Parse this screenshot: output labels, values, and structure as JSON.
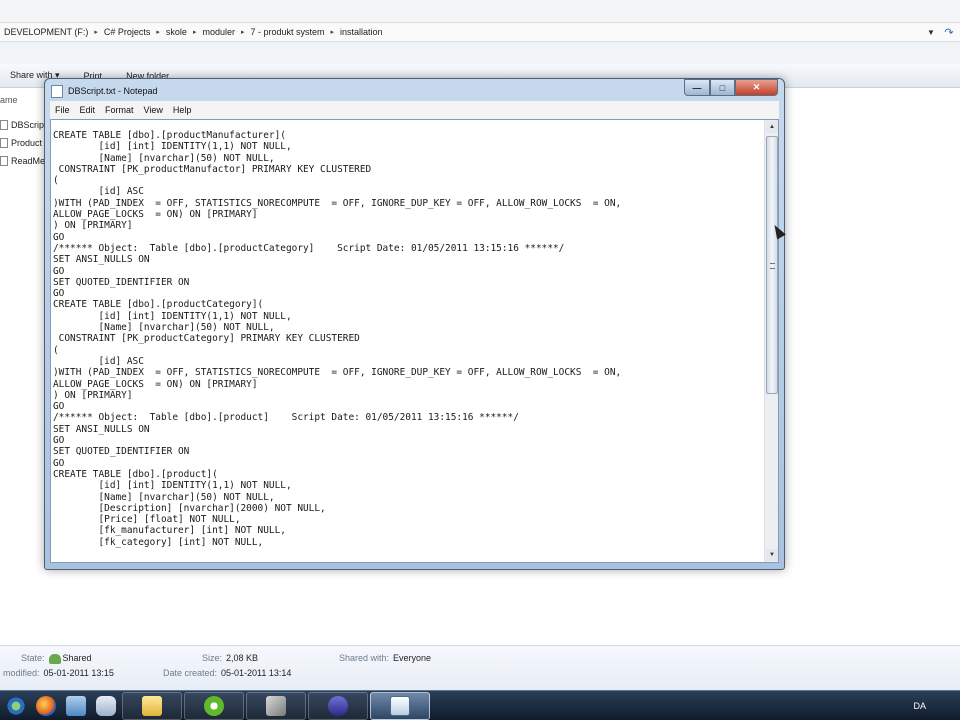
{
  "explorer": {
    "breadcrumbs": [
      "DEVELOPMENT (F:)",
      "C# Projects",
      "skole",
      "moduler",
      "7 - produkt system",
      "installation"
    ],
    "toolbar": {
      "share_with": "Share with ▾",
      "print": "Print",
      "new_folder": "New folder"
    },
    "column_header": "ame",
    "nav_items": [
      "DBScrip",
      "Product",
      "ReadMe"
    ],
    "details": {
      "state_label": "State:",
      "state_value": "Shared",
      "size_label": "Size:",
      "size_value": "2,08 KB",
      "shared_with_label": "Shared with:",
      "shared_with_value": "Everyone",
      "modified_label": "modified:",
      "modified_value": "05-01-2011 13:15",
      "created_label": "Date created:",
      "created_value": "05-01-2011 13:14"
    }
  },
  "notepad": {
    "title": "DBScript.txt - Notepad",
    "menu": [
      "File",
      "Edit",
      "Format",
      "View",
      "Help"
    ],
    "lines": [
      "CREATE TABLE [dbo].[productManufacturer](",
      "        [id] [int] IDENTITY(1,1) NOT NULL,",
      "        [Name] [nvarchar](50) NOT NULL,",
      " CONSTRAINT [PK_productManufactor] PRIMARY KEY CLUSTERED",
      "(",
      "        [id] ASC",
      ")WITH (PAD_INDEX  = OFF, STATISTICS_NORECOMPUTE  = OFF, IGNORE_DUP_KEY = OFF, ALLOW_ROW_LOCKS  = ON,",
      "ALLOW_PAGE_LOCKS  = ON) ON [PRIMARY]",
      ") ON [PRIMARY]",
      "GO",
      "/****** Object:  Table [dbo].[productCategory]    Script Date: 01/05/2011 13:15:16 ******/",
      "SET ANSI_NULLS ON",
      "GO",
      "SET QUOTED_IDENTIFIER ON",
      "GO",
      "CREATE TABLE [dbo].[productCategory](",
      "        [id] [int] IDENTITY(1,1) NOT NULL,",
      "        [Name] [nvarchar](50) NOT NULL,",
      " CONSTRAINT [PK_productCategory] PRIMARY KEY CLUSTERED",
      "(",
      "        [id] ASC",
      ")WITH (PAD_INDEX  = OFF, STATISTICS_NORECOMPUTE  = OFF, IGNORE_DUP_KEY = OFF, ALLOW_ROW_LOCKS  = ON,",
      "ALLOW_PAGE_LOCKS  = ON) ON [PRIMARY]",
      ") ON [PRIMARY]",
      "GO",
      "/****** Object:  Table [dbo].[product]    Script Date: 01/05/2011 13:15:16 ******/",
      "SET ANSI_NULLS ON",
      "GO",
      "SET QUOTED_IDENTIFIER ON",
      "GO",
      "CREATE TABLE [dbo].[product](",
      "        [id] [int] IDENTITY(1,1) NOT NULL,",
      "        [Name] [nvarchar](50) NOT NULL,",
      "        [Description] [nvarchar](2000) NOT NULL,",
      "        [Price] [float] NOT NULL,",
      "        [fk_manufacturer] [int] NOT NULL,",
      "        [fk_category] [int] NOT NULL,"
    ]
  },
  "taskbar": {
    "language": "DA",
    "icons": [
      "start-orb",
      "firefox",
      "explorer",
      "files",
      "folder",
      "utorrent",
      "tools",
      "media",
      "notepad"
    ]
  },
  "colors": {
    "taskbar": "#1a2a3e",
    "notepad_frame": "#b9cfe6",
    "close_button": "#c7442f"
  }
}
